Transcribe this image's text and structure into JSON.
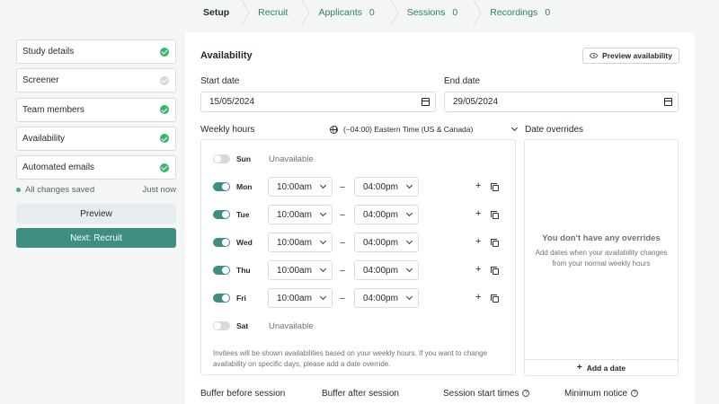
{
  "steps": [
    {
      "label": "Setup",
      "count": ""
    },
    {
      "label": "Recruit",
      "count": ""
    },
    {
      "label": "Applicants",
      "count": "0"
    },
    {
      "label": "Sessions",
      "count": "0"
    },
    {
      "label": "Recordings",
      "count": "0"
    }
  ],
  "sidebar": {
    "items": [
      {
        "label": "Study details",
        "done": true
      },
      {
        "label": "Screener",
        "done": false
      },
      {
        "label": "Team members",
        "done": true
      },
      {
        "label": "Availability",
        "done": true
      },
      {
        "label": "Automated emails",
        "done": true
      }
    ],
    "saved_text": "All changes saved",
    "saved_time": "Just now",
    "preview_label": "Preview",
    "next_label": "Next: Recruit"
  },
  "availability": {
    "title": "Availability",
    "preview_button": "Preview availability",
    "start_date_label": "Start date",
    "start_date": "15/05/2024",
    "end_date_label": "End date",
    "end_date": "29/05/2024",
    "weekly_hours_label": "Weekly hours",
    "timezone": "(−04:00) Eastern Time (US & Canada)",
    "unavailable_text": "Unavailable",
    "days": [
      {
        "day": "Sun",
        "on": false,
        "start": "",
        "end": ""
      },
      {
        "day": "Mon",
        "on": true,
        "start": "10:00am",
        "end": "04:00pm"
      },
      {
        "day": "Tue",
        "on": true,
        "start": "10:00am",
        "end": "04:00pm"
      },
      {
        "day": "Wed",
        "on": true,
        "start": "10:00am",
        "end": "04:00pm"
      },
      {
        "day": "Thu",
        "on": true,
        "start": "10:00am",
        "end": "04:00pm"
      },
      {
        "day": "Fri",
        "on": true,
        "start": "10:00am",
        "end": "04:00pm"
      },
      {
        "day": "Sat",
        "on": false,
        "start": "",
        "end": ""
      }
    ],
    "note": "Invitees will be shown availabilities based on your weekly hours. If you want to change availability on specific days, please add a date override.",
    "date_overrides_label": "Date overrides",
    "no_overrides_title": "You don't have any overrides",
    "no_overrides_sub": "Add dates when your availability changes from your normal weekly hours",
    "add_date_label": "Add a date",
    "bottom_labels": {
      "buffer_before": "Buffer before session",
      "buffer_after": "Buffer after session",
      "start_times": "Session start times",
      "min_notice": "Minimum notice"
    }
  },
  "colors": {
    "accent": "#3e8f82",
    "check": "#3cb371"
  }
}
